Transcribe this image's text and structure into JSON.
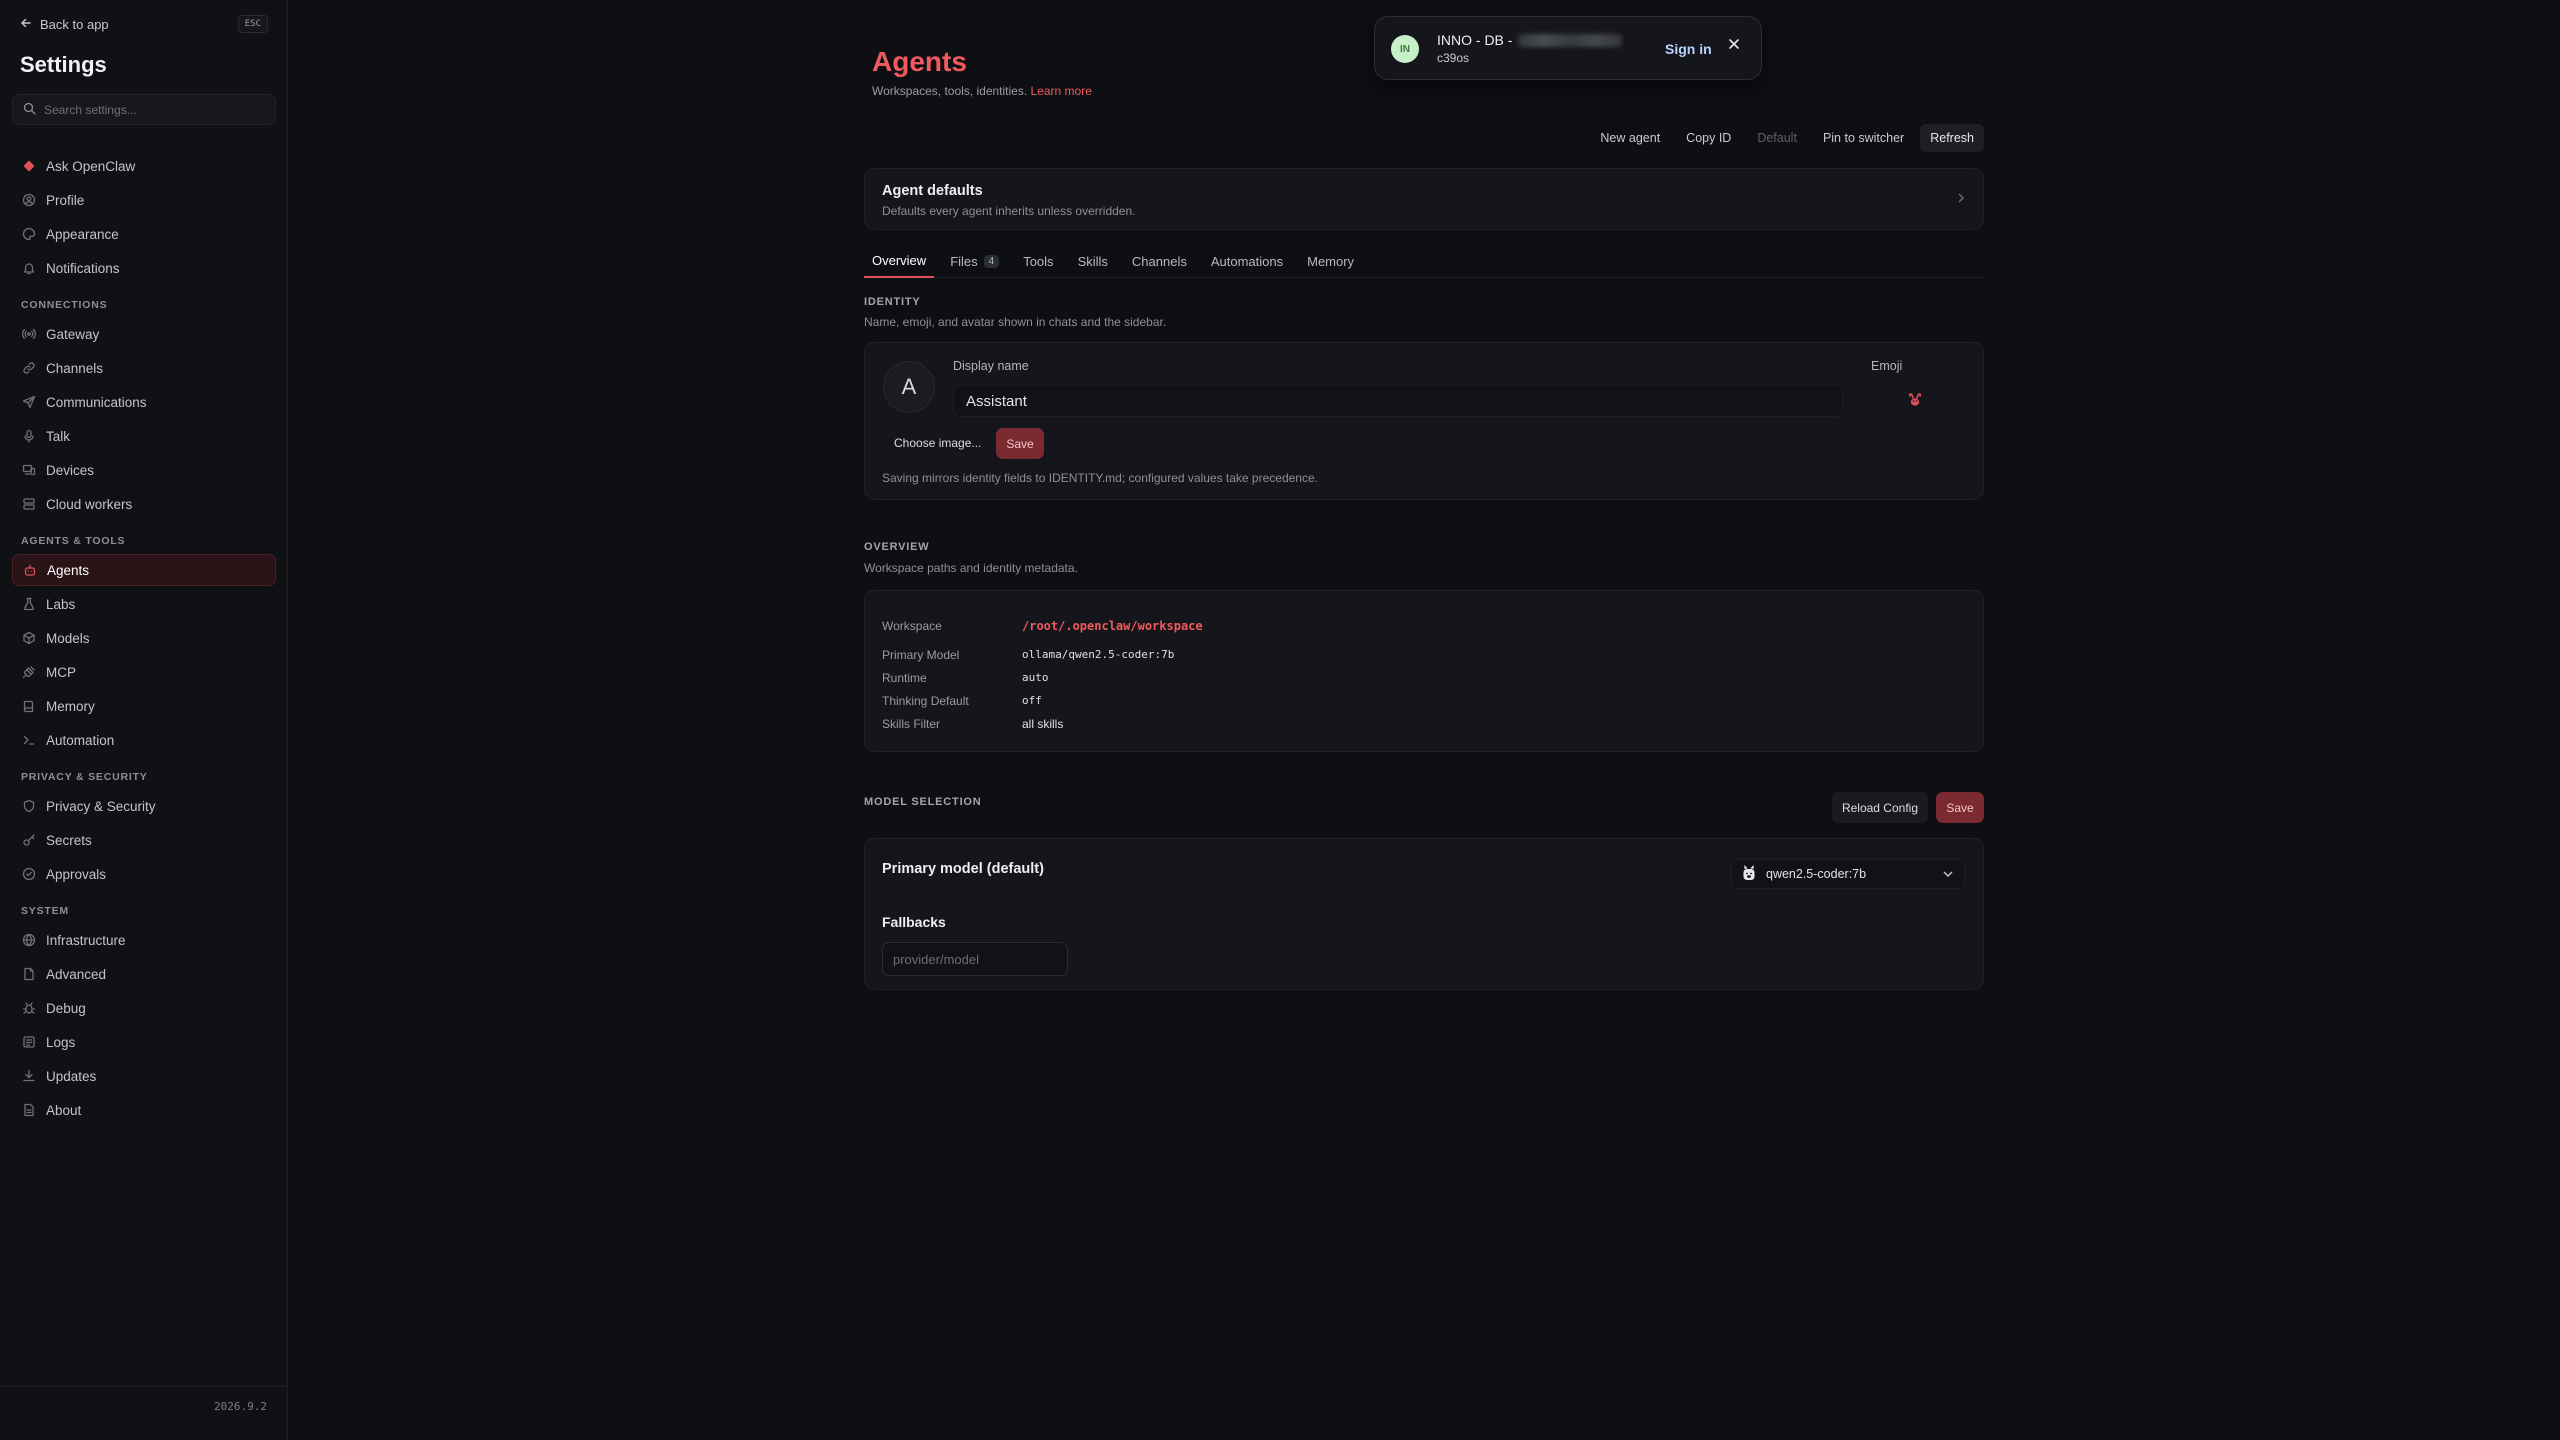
{
  "sidebar": {
    "back_label": "Back to app",
    "esc_label": "ESC",
    "title": "Settings",
    "search_placeholder": "Search settings...",
    "version": "2026.9.2",
    "top_items": [
      {
        "label": "Ask OpenClaw",
        "icon": "claw-logo-icon"
      },
      {
        "label": "Profile",
        "icon": "user-circle-icon"
      },
      {
        "label": "Appearance",
        "icon": "palette-icon"
      },
      {
        "label": "Notifications",
        "icon": "bell-icon"
      }
    ],
    "sections": [
      {
        "title": "CONNECTIONS",
        "items": [
          {
            "label": "Gateway",
            "icon": "broadcast-icon"
          },
          {
            "label": "Channels",
            "icon": "link-icon"
          },
          {
            "label": "Communications",
            "icon": "send-icon"
          },
          {
            "label": "Talk",
            "icon": "microphone-icon"
          },
          {
            "label": "Devices",
            "icon": "devices-icon"
          },
          {
            "label": "Cloud workers",
            "icon": "server-icon"
          }
        ]
      },
      {
        "title": "AGENTS & TOOLS",
        "items": [
          {
            "label": "Agents",
            "icon": "bot-icon",
            "active": true
          },
          {
            "label": "Labs",
            "icon": "flask-icon"
          },
          {
            "label": "Models",
            "icon": "cube-icon"
          },
          {
            "label": "MCP",
            "icon": "plug-icon"
          },
          {
            "label": "Memory",
            "icon": "book-icon"
          },
          {
            "label": "Automation",
            "icon": "terminal-icon"
          }
        ]
      },
      {
        "title": "PRIVACY & SECURITY",
        "items": [
          {
            "label": "Privacy & Security",
            "icon": "shield-icon"
          },
          {
            "label": "Secrets",
            "icon": "key-icon"
          },
          {
            "label": "Approvals",
            "icon": "check-circle-icon"
          }
        ]
      },
      {
        "title": "SYSTEM",
        "items": [
          {
            "label": "Infrastructure",
            "icon": "globe-icon"
          },
          {
            "label": "Advanced",
            "icon": "file-icon"
          },
          {
            "label": "Debug",
            "icon": "bug-icon"
          },
          {
            "label": "Logs",
            "icon": "log-icon"
          },
          {
            "label": "Updates",
            "icon": "download-icon"
          },
          {
            "label": "About",
            "icon": "document-icon"
          }
        ]
      }
    ]
  },
  "toast": {
    "avatar_initials": "IN",
    "title": "INNO - DB -",
    "subtitle": "c39os",
    "sign_in": "Sign in"
  },
  "page": {
    "title": "Agents",
    "subtitle": "Workspaces, tools, identities.",
    "learn_more": "Learn more"
  },
  "toolbar": {
    "new_agent": "New agent",
    "copy_id": "Copy ID",
    "default": "Default",
    "pin": "Pin to switcher",
    "refresh": "Refresh"
  },
  "defaults_card": {
    "title": "Agent defaults",
    "subtitle": "Defaults every agent inherits unless overridden."
  },
  "tabs": [
    {
      "label": "Overview",
      "active": true
    },
    {
      "label": "Files",
      "badge": "4"
    },
    {
      "label": "Tools"
    },
    {
      "label": "Skills"
    },
    {
      "label": "Channels"
    },
    {
      "label": "Automations"
    },
    {
      "label": "Memory"
    }
  ],
  "identity": {
    "section_title": "IDENTITY",
    "section_sub": "Name, emoji, and avatar shown in chats and the sidebar.",
    "avatar_letter": "A",
    "display_name_label": "Display name",
    "display_name_value": "Assistant",
    "emoji_label": "Emoji",
    "choose_image": "Choose image...",
    "save": "Save",
    "note": "Saving mirrors identity fields to IDENTITY.md; configured values take precedence."
  },
  "overview": {
    "section_title": "OVERVIEW",
    "section_sub": "Workspace paths and identity metadata.",
    "rows": [
      {
        "key": "Workspace",
        "value": "/root/.openclaw/workspace"
      },
      {
        "key": "Primary Model",
        "value": "ollama/qwen2.5-coder:7b"
      },
      {
        "key": "Runtime",
        "value": "auto"
      },
      {
        "key": "Thinking Default",
        "value": "off"
      },
      {
        "key": "Skills Filter",
        "value": "all skills"
      }
    ]
  },
  "model_selection": {
    "section_title": "MODEL SELECTION",
    "reload": "Reload Config",
    "save": "Save",
    "primary_label": "Primary model (default)",
    "selected_model": "qwen2.5-coder:7b",
    "fallbacks_label": "Fallbacks",
    "fallback_placeholder": "provider/model"
  },
  "colors": {
    "accent": "#ef5a5f",
    "background": "#0e0f13",
    "sidebar": "#101115",
    "card": "#15161b",
    "save_button": "#7a2a30"
  }
}
